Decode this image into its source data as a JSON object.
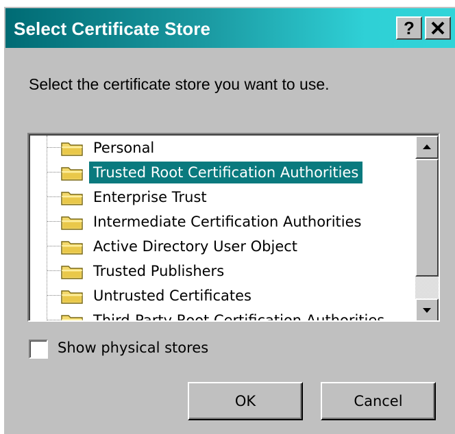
{
  "dialog": {
    "title": "Select Certificate Store",
    "help_glyph": "?",
    "close_glyph": "✕",
    "prompt": "Select the certificate store you want to use."
  },
  "tree": {
    "items": [
      {
        "label": "Personal",
        "selected": false
      },
      {
        "label": "Trusted Root Certification Authorities",
        "selected": true
      },
      {
        "label": "Enterprise Trust",
        "selected": false
      },
      {
        "label": "Intermediate Certification Authorities",
        "selected": false
      },
      {
        "label": "Active Directory User Object",
        "selected": false
      },
      {
        "label": "Trusted Publishers",
        "selected": false
      },
      {
        "label": "Untrusted Certificates",
        "selected": false
      },
      {
        "label": "Third-Party Root Certification Authorities",
        "selected": false
      }
    ]
  },
  "options": {
    "show_physical_label": "Show physical stores",
    "show_physical_checked": false
  },
  "buttons": {
    "ok_label": "OK",
    "cancel_label": "Cancel"
  },
  "colors": {
    "title_gradient_start": "#006b74",
    "title_gradient_end": "#30d4d8",
    "selection": "#0a7a7e",
    "dialog_face": "#c0c0c0"
  },
  "icons": {
    "tree_item": "folder-icon",
    "scroll_up": "arrow-up-icon",
    "scroll_down": "arrow-down-icon"
  }
}
